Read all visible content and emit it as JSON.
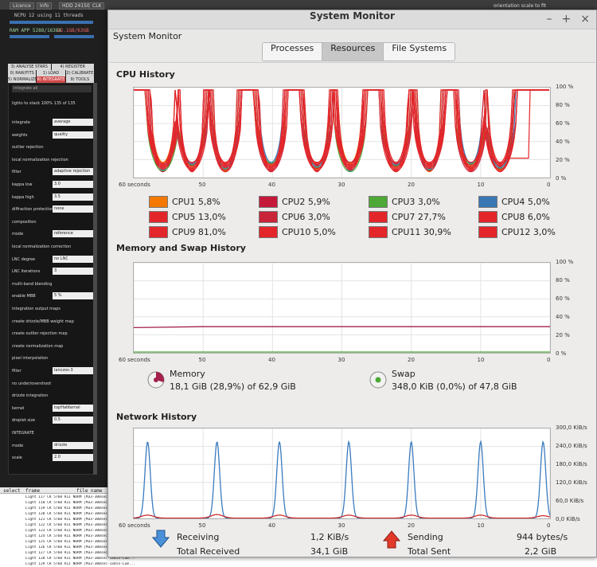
{
  "background_app": {
    "top_chips": [
      "Licence",
      "Info",
      "HDD 24150",
      "CLK"
    ],
    "status": "NCPU 12  using 11 threads",
    "ram": "RAM  APP 5288/16384",
    "ram_alert": "22.1GB/63GB",
    "tabs_row1": [
      "3) ANALYSE STARS",
      "4) REGISTER"
    ],
    "tabs_row2": [
      "0) RAW/FITS",
      "1) LOAD",
      "2) CALIBRATE"
    ],
    "tabs_row3": [
      "5) NORMALIZE",
      "6) INTEGRATE",
      "9) TOOLS"
    ],
    "integrate_button": "integrate all",
    "lights_to_stack": "lights to stack 100%    135 of 135",
    "rows": [
      {
        "label": "integrate",
        "value": "average"
      },
      {
        "label": "weights",
        "value": "quality"
      },
      {
        "label": "outlier rejection",
        "value": ""
      },
      {
        "label": "local normalization rejection",
        "value": ""
      },
      {
        "label": "filter",
        "value": "adaptive rejection"
      },
      {
        "label": "kappa low",
        "value": "3.0"
      },
      {
        "label": "kappa high",
        "value": "3.5"
      },
      {
        "label": "diffraction protection",
        "value": "none"
      },
      {
        "label": "composition",
        "value": ""
      },
      {
        "label": "mode",
        "value": "reference"
      },
      {
        "label": "local normalization correction",
        "value": ""
      },
      {
        "label": "LNC degree",
        "value": "no LNC"
      },
      {
        "label": "LNC iterations",
        "value": "3"
      },
      {
        "label": "multi-band blending",
        "value": ""
      },
      {
        "label": "enable MBB",
        "value": "5  %"
      },
      {
        "label": "integration output maps",
        "value": ""
      },
      {
        "label": "create drizzle/MBB weight map",
        "value": ""
      },
      {
        "label": "create outlier rejection map",
        "value": ""
      },
      {
        "label": "create normalization map",
        "value": ""
      },
      {
        "label": "pixel interpolation",
        "value": ""
      },
      {
        "label": "filter",
        "value": "lanczos-3"
      },
      {
        "label": "no under/overshoot",
        "value": ""
      },
      {
        "label": "drizzle integration",
        "value": ""
      },
      {
        "label": "kernel",
        "value": "topHatKernel"
      },
      {
        "label": "droplet size",
        "value": "0.5"
      },
      {
        "label": "INTEGRATE",
        "value": ""
      },
      {
        "label": "mode",
        "value": "drizzle"
      },
      {
        "label": "scale",
        "value": "2.0"
      }
    ],
    "table_headers": [
      "select",
      "frame",
      "file name"
    ],
    "table_rows": [
      "Light 117   CR 5760 R11 NORM   |M33-300sec-1xBin-Lum...",
      "Light 118   CR 5760 R11 NORM   |M33-300sec-1xBin-Lum...",
      "Light 119   CR 5760 R11 NORM   |M33-300sec-1xBin-Lum...",
      "Light 120   CR 5760 R11 NORM   |M33-300sec-1xBin-Lum...",
      "Light 121   CR 5760 R11 NORM   |M33-300sec-1xBin-Lum...",
      "Light 122   CR 5760 R11 NORM   |M33-300sec-1xBin-Lum...",
      "Light 123   CR 5760 R11 NORM   |M33-300sec-1xBin-Lum...",
      "Light 124   CR 5760 R11 NORM   |M33-300sec-1xBin-Lum...",
      "Light 125   CR 5760 R11 NORM   |M33-300sec-1xBin-Lum...",
      "Light 126   CR 5760 R11 NORM   |M33-300sec-1xBin-Lum...",
      "Light 127   CR 5760 R11 NORM   |M33-300sec-1xBin-Lum...",
      "Light 128   CR 5760 R11 NORM   |M33-300sec-1xBin-Lum...",
      "Light 129   CR 5760 R11 NORM   |M33-300sec-1xBin-Lum...",
      "Light 130   CR 5760 R11 NORM   |M33-300sec-1xBin-Lum..."
    ],
    "top_right": "orientation    scale to fit"
  },
  "window": {
    "title": "System Monitor",
    "app_label": "System Monitor",
    "controls": [
      "–",
      "+",
      "×"
    ],
    "tabs": [
      {
        "label": "Processes",
        "active": false
      },
      {
        "label": "Resources",
        "active": true
      },
      {
        "label": "File Systems",
        "active": false
      }
    ]
  },
  "cpu": {
    "title": "CPU History",
    "y_ticks": [
      "100 %",
      "80 %",
      "60 %",
      "40 %",
      "20 %",
      "0 %"
    ],
    "x_ticks": [
      "60 seconds",
      "50",
      "40",
      "30",
      "20",
      "10",
      "0"
    ],
    "legend": [
      {
        "label": "CPU1 5,8%",
        "color": "#f57900"
      },
      {
        "label": "CPU2 5,9%",
        "color": "#c4193a"
      },
      {
        "label": "CPU3 3,0%",
        "color": "#4ea836"
      },
      {
        "label": "CPU4 5,0%",
        "color": "#3a78b5"
      },
      {
        "label": "CPU5 13,0%",
        "color": "#e3262a"
      },
      {
        "label": "CPU6 3,0%",
        "color": "#c9243a"
      },
      {
        "label": "CPU7 27,7%",
        "color": "#e3262a"
      },
      {
        "label": "CPU8 6,0%",
        "color": "#e3262a"
      },
      {
        "label": "CPU9 81,0%",
        "color": "#e3262a"
      },
      {
        "label": "CPU10 5,0%",
        "color": "#e3262a"
      },
      {
        "label": "CPU11 30,9%",
        "color": "#e3262a"
      },
      {
        "label": "CPU12 3,0%",
        "color": "#e3262a"
      }
    ]
  },
  "memory": {
    "title": "Memory and Swap History",
    "y_ticks": [
      "100 %",
      "80 %",
      "60 %",
      "40 %",
      "20 %",
      "0 %"
    ],
    "x_ticks": [
      "60 seconds",
      "50",
      "40",
      "30",
      "20",
      "10",
      "0"
    ],
    "memory_label": "Memory",
    "memory_value": "18,1 GiB (28,9%) of 62,9 GiB",
    "swap_label": "Swap",
    "swap_value": "348,0 KiB (0,0%) of 47,8 GiB",
    "memory_color": "#a3214b",
    "swap_color": "#4ea836"
  },
  "network": {
    "title": "Network History",
    "y_ticks": [
      "300,0 KiB/s",
      "240,0 KiB/s",
      "180,0 KiB/s",
      "120,0 KiB/s",
      "60,0 KiB/s",
      "0,0 KiB/s"
    ],
    "x_ticks": [
      "60 seconds",
      "50",
      "40",
      "30",
      "20",
      "10",
      "0"
    ],
    "receiving_label": "Receiving",
    "receiving_value": "1,2 KiB/s",
    "total_received_label": "Total Received",
    "total_received_value": "34,1 GiB",
    "sending_label": "Sending",
    "sending_value": "944 bytes/s",
    "total_sent_label": "Total Sent",
    "total_sent_value": "2,2 GiB",
    "receive_color": "#3a7bc0",
    "send_color": "#cc2020"
  },
  "chart_data": [
    {
      "type": "line",
      "title": "CPU History",
      "x": [
        60,
        55,
        50,
        45,
        40,
        35,
        30,
        25,
        20,
        15,
        10,
        5,
        0
      ],
      "xlabel": "seconds",
      "ylim": [
        0,
        100
      ],
      "note_series": "12 CPU cores oscillating between ~5% and ~100%",
      "series": [
        {
          "name": "CPU1",
          "values": [
            100,
            10,
            100,
            12,
            100,
            15,
            100,
            12,
            100,
            10,
            100,
            30,
            100
          ]
        },
        {
          "name": "CPU9",
          "values": [
            100,
            8,
            100,
            10,
            100,
            8,
            100,
            10,
            100,
            8,
            100,
            10,
            100
          ]
        }
      ]
    },
    {
      "type": "line",
      "title": "Memory and Swap History",
      "xlabel": "seconds",
      "ylim": [
        0,
        100
      ],
      "x": [
        60,
        50,
        40,
        30,
        20,
        10,
        0
      ],
      "series": [
        {
          "name": "Memory",
          "values": [
            28,
            29,
            29,
            29,
            29,
            29,
            29
          ]
        },
        {
          "name": "Swap",
          "values": [
            0,
            0,
            0,
            0,
            0,
            0,
            0
          ]
        }
      ]
    },
    {
      "type": "line",
      "title": "Network History",
      "xlabel": "seconds",
      "ylim": [
        0,
        300
      ],
      "x": [
        58,
        48,
        39,
        29,
        20,
        10,
        1
      ],
      "series": [
        {
          "name": "Receiving",
          "values": [
            255,
            255,
            255,
            255,
            255,
            255,
            255
          ]
        },
        {
          "name": "Sending",
          "values": [
            10,
            12,
            10,
            10,
            10,
            10,
            8
          ]
        }
      ]
    }
  ]
}
